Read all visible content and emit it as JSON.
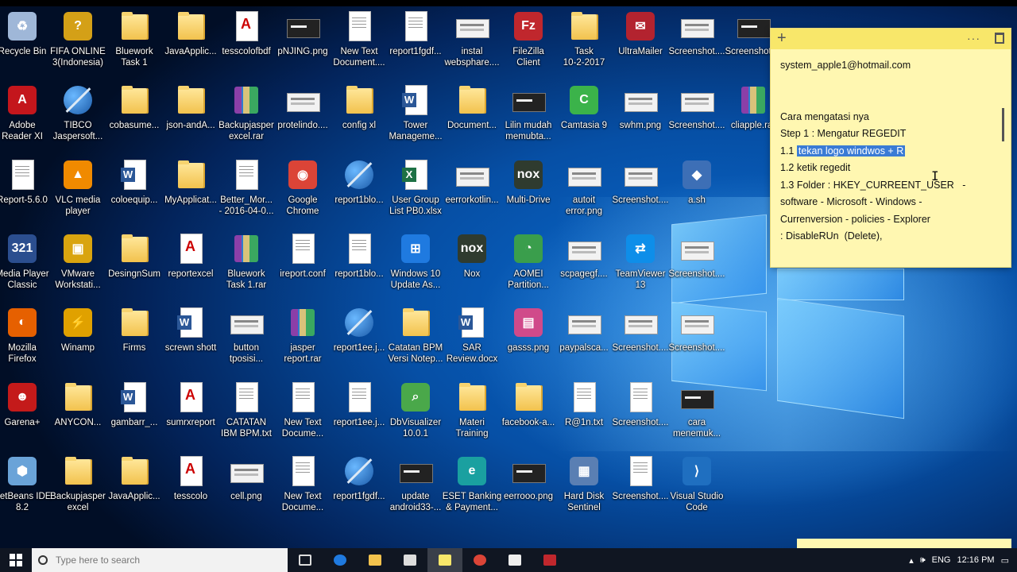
{
  "desktop": {
    "icons": [
      {
        "label": "Recycle Bin",
        "kind": "app",
        "icon": "recycle-bin-icon",
        "color": "#9fb7d8",
        "glyph": "♻"
      },
      {
        "label": "FIFA ONLINE\n3(Indonesia)",
        "kind": "app",
        "icon": "fifa-icon",
        "color": "#d4a017",
        "glyph": "?"
      },
      {
        "label": "Bluework\nTask 1",
        "kind": "folder",
        "icon": "folder-icon"
      },
      {
        "label": "JavaApplic...",
        "kind": "folder",
        "icon": "folder-icon"
      },
      {
        "label": "tesscolofbdf",
        "kind": "pdf",
        "icon": "pdf-folder-icon"
      },
      {
        "label": "pNJING.png",
        "kind": "dark",
        "icon": "image-file-icon"
      },
      {
        "label": "New Text\nDocument....",
        "kind": "doc",
        "icon": "text-file-icon"
      },
      {
        "label": "report1fgdf...",
        "kind": "doc",
        "icon": "report-file-icon"
      },
      {
        "label": "instal\nwebsphare....",
        "kind": "img",
        "icon": "image-file-icon"
      },
      {
        "label": "FileZilla\nClient",
        "kind": "app",
        "icon": "filezilla-icon",
        "color": "#c0272d",
        "glyph": "Fz"
      },
      {
        "label": "Task\n10-2-2017",
        "kind": "folder",
        "icon": "folder-icon"
      },
      {
        "label": "UltraMailer",
        "kind": "app",
        "icon": "ultramailer-icon",
        "color": "#b3232f",
        "glyph": "✉"
      },
      {
        "label": "Screenshot....",
        "kind": "img",
        "icon": "image-file-icon"
      },
      {
        "label": "Screenshot....",
        "kind": "dark",
        "icon": "image-file-icon"
      },
      {
        "label": "Adobe\nReader XI",
        "kind": "app",
        "icon": "adobe-reader-icon",
        "color": "#c4161c",
        "glyph": "A"
      },
      {
        "label": "TIBCO\nJaspersoft...",
        "kind": "ball",
        "icon": "jaspersoft-icon"
      },
      {
        "label": "cobasume...",
        "kind": "folder",
        "icon": "folder-icon"
      },
      {
        "label": "json-andA...",
        "kind": "folder",
        "icon": "folder-icon"
      },
      {
        "label": "Backupjasper\nexcel.rar",
        "kind": "rar",
        "icon": "rar-archive-icon"
      },
      {
        "label": "protelindo....",
        "kind": "img",
        "icon": "image-file-icon"
      },
      {
        "label": "config xl",
        "kind": "folder",
        "icon": "folder-icon"
      },
      {
        "label": "Tower\nManageme...",
        "kind": "word",
        "icon": "word-document-icon"
      },
      {
        "label": "Document...",
        "kind": "folder",
        "icon": "folder-icon"
      },
      {
        "label": "Lilin mudah\nmemubta...",
        "kind": "dark",
        "icon": "image-file-icon"
      },
      {
        "label": "Camtasia 9",
        "kind": "app",
        "icon": "camtasia-icon",
        "color": "#3bb34a",
        "glyph": "C"
      },
      {
        "label": "swhm.png",
        "kind": "img",
        "icon": "image-file-icon"
      },
      {
        "label": "Screenshot....",
        "kind": "img",
        "icon": "image-file-icon"
      },
      {
        "label": "cliapple.rar",
        "kind": "rar",
        "icon": "rar-archive-icon"
      },
      {
        "label": "Report-5.6.0",
        "kind": "doc",
        "icon": "report-file-icon"
      },
      {
        "label": "VLC media\nplayer",
        "kind": "app",
        "icon": "vlc-icon",
        "color": "#f08a00",
        "glyph": "▲"
      },
      {
        "label": "coloequip...",
        "kind": "word",
        "icon": "word-folder-icon"
      },
      {
        "label": "MyApplicat...",
        "kind": "folder",
        "icon": "folder-icon"
      },
      {
        "label": "Better_Mor...\n- 2016-04-0...",
        "kind": "doc",
        "icon": "text-file-icon"
      },
      {
        "label": "Google\nChrome",
        "kind": "app",
        "icon": "chrome-icon",
        "color": "#db4437",
        "glyph": "◉"
      },
      {
        "label": "report1blo...",
        "kind": "ball",
        "icon": "jaspersoft-icon"
      },
      {
        "label": "User Group\nList PB0.xlsx",
        "kind": "excel",
        "icon": "excel-file-icon"
      },
      {
        "label": "eerrorkotlin...",
        "kind": "img",
        "icon": "image-file-icon"
      },
      {
        "label": "Multi-Drive",
        "kind": "app",
        "icon": "nox-multidrive-icon",
        "color": "#2f3b2f",
        "glyph": "nox"
      },
      {
        "label": "autoit\nerror.png",
        "kind": "img",
        "icon": "image-file-icon"
      },
      {
        "label": "Screenshot....",
        "kind": "img",
        "icon": "image-file-icon"
      },
      {
        "label": "a.sh",
        "kind": "app",
        "icon": "git-bash-icon",
        "color": "#3d6fb6",
        "glyph": "◆"
      },
      {
        "label": "Media Player\nClassic",
        "kind": "app",
        "icon": "media-player-classic-icon",
        "color": "#2b4e8f",
        "glyph": "321"
      },
      {
        "label": "VMware\nWorkstati...",
        "kind": "app",
        "icon": "vmware-icon",
        "color": "#d9a40f",
        "glyph": "▣"
      },
      {
        "label": "DesingnSum",
        "kind": "folder",
        "icon": "folder-icon"
      },
      {
        "label": "reportexcel",
        "kind": "pdf",
        "icon": "pdf-folder-icon"
      },
      {
        "label": "Bluework\nTask 1.rar",
        "kind": "rar",
        "icon": "rar-archive-icon"
      },
      {
        "label": "ireport.conf",
        "kind": "doc",
        "icon": "text-file-icon"
      },
      {
        "label": "report1blo...",
        "kind": "doc",
        "icon": "report-file-icon"
      },
      {
        "label": "Windows 10\nUpdate As...",
        "kind": "app",
        "icon": "windows-update-icon",
        "color": "#1f7ae0",
        "glyph": "⊞"
      },
      {
        "label": "Nox",
        "kind": "app",
        "icon": "nox-icon",
        "color": "#2f3b2f",
        "glyph": "nox"
      },
      {
        "label": "AOMEI\nPartition...",
        "kind": "app",
        "icon": "aomei-icon",
        "color": "#3a9e4c",
        "glyph": "◔"
      },
      {
        "label": "scpagegf....",
        "kind": "img",
        "icon": "image-file-icon"
      },
      {
        "label": "TeamViewer\n13",
        "kind": "app",
        "icon": "teamviewer-icon",
        "color": "#0e8ee9",
        "glyph": "⇄"
      },
      {
        "label": "Screenshot....",
        "kind": "img",
        "icon": "image-file-icon"
      },
      {
        "label": "Mozilla\nFirefox",
        "kind": "app",
        "icon": "firefox-icon",
        "color": "#e66000",
        "glyph": "◐"
      },
      {
        "label": "Winamp",
        "kind": "app",
        "icon": "winamp-icon",
        "color": "#e0a100",
        "glyph": "⚡"
      },
      {
        "label": "Firms",
        "kind": "folder",
        "icon": "folder-icon"
      },
      {
        "label": "screwn shott",
        "kind": "word",
        "icon": "word-folder-icon"
      },
      {
        "label": "button\ntposisi...",
        "kind": "img",
        "icon": "image-file-icon"
      },
      {
        "label": "jasper\nreport.rar",
        "kind": "rar",
        "icon": "rar-archive-icon"
      },
      {
        "label": "report1ee.j...",
        "kind": "ball",
        "icon": "jaspersoft-icon"
      },
      {
        "label": "Catatan BPM\nVersi Notep...",
        "kind": "folder",
        "icon": "folder-icon"
      },
      {
        "label": "SAR\nReview.docx",
        "kind": "word",
        "icon": "word-document-icon"
      },
      {
        "label": "gasss.png",
        "kind": "app",
        "icon": "image-file-icon",
        "color": "#d04a8a",
        "glyph": "▤"
      },
      {
        "label": "paypalsca...",
        "kind": "img",
        "icon": "image-file-icon"
      },
      {
        "label": "Screenshot....",
        "kind": "img",
        "icon": "image-file-icon"
      },
      {
        "label": "Screenshot....",
        "kind": "img",
        "icon": "image-file-icon"
      },
      {
        "label": "Garena+",
        "kind": "app",
        "icon": "garena-icon",
        "color": "#c41a1a",
        "glyph": "☻"
      },
      {
        "label": "ANYCON...",
        "kind": "folder",
        "icon": "folder-icon"
      },
      {
        "label": "gambarr_...",
        "kind": "word",
        "icon": "word-folder-icon"
      },
      {
        "label": "sumrxreport",
        "kind": "pdf",
        "icon": "pdf-folder-icon"
      },
      {
        "label": "CATATAN\nIBM BPM.txt",
        "kind": "doc",
        "icon": "text-file-icon"
      },
      {
        "label": "New Text\nDocume...",
        "kind": "doc",
        "icon": "text-file-icon"
      },
      {
        "label": "report1ee.j...",
        "kind": "doc",
        "icon": "report-file-icon"
      },
      {
        "label": "DbVisualizer\n10.0.1",
        "kind": "app",
        "icon": "dbvisualizer-icon",
        "color": "#4aa84a",
        "glyph": "⌕"
      },
      {
        "label": "Materi\nTraining",
        "kind": "folder",
        "icon": "folder-icon"
      },
      {
        "label": "facebook-a...",
        "kind": "folder",
        "icon": "folder-icon"
      },
      {
        "label": "R@1n.txt",
        "kind": "doc",
        "icon": "text-file-icon"
      },
      {
        "label": "Screenshot....",
        "kind": "doc",
        "icon": "image-file-icon"
      },
      {
        "label": "cara\nmenemuk...",
        "kind": "dark",
        "icon": "image-file-icon"
      },
      {
        "label": "NetBeans IDE\n8.2",
        "kind": "app",
        "icon": "netbeans-icon",
        "color": "#6aa3d8",
        "glyph": "⬢"
      },
      {
        "label": "Backupjasper\nexcel",
        "kind": "folder",
        "icon": "folder-icon"
      },
      {
        "label": "JavaApplic...",
        "kind": "folder",
        "icon": "folder-icon"
      },
      {
        "label": "tesscolo",
        "kind": "pdf",
        "icon": "pdf-folder-icon"
      },
      {
        "label": "cell.png",
        "kind": "img",
        "icon": "image-file-icon"
      },
      {
        "label": "New Text\nDocume...",
        "kind": "doc",
        "icon": "text-file-icon"
      },
      {
        "label": "report1fgdf...",
        "kind": "ball",
        "icon": "jaspersoft-icon"
      },
      {
        "label": "update\nandroid33-...",
        "kind": "dark",
        "icon": "image-file-icon"
      },
      {
        "label": "ESET Banking\n& Payment...",
        "kind": "app",
        "icon": "eset-icon",
        "color": "#1aa0a0",
        "glyph": "e"
      },
      {
        "label": "eerrooo.png",
        "kind": "dark",
        "icon": "image-file-icon"
      },
      {
        "label": "Hard Disk\nSentinel",
        "kind": "app",
        "icon": "hard-disk-sentinel-icon",
        "color": "#5a7fb3",
        "glyph": "▦"
      },
      {
        "label": "Screenshot....",
        "kind": "doc",
        "icon": "image-file-icon"
      },
      {
        "label": "Visual Studio\nCode",
        "kind": "app",
        "icon": "vscode-icon",
        "color": "#1f6fc0",
        "glyph": "⟩"
      }
    ]
  },
  "sticky_note": {
    "add_label": "+",
    "more_label": "···",
    "lines": [
      {
        "text": "system_apple1@hotmail.com",
        "selected": ""
      },
      {
        "text": "",
        "selected": ""
      },
      {
        "text": "",
        "selected": ""
      },
      {
        "text": "Cara mengatasi nya",
        "selected": ""
      },
      {
        "text": "Step 1 : Mengatur REGEDIT",
        "selected": ""
      },
      {
        "text": "1.1 ",
        "selected": "tekan logo windwos + R"
      },
      {
        "text": "1.2 ketik regedit",
        "selected": ""
      },
      {
        "text": "1.3 Folder : HKEY_CURREENT_USER   -",
        "selected": ""
      },
      {
        "text": "software - Microsoft - Windows -",
        "selected": ""
      },
      {
        "text": "Currenversion - policies - Explorer",
        "selected": ""
      },
      {
        "text": ": DisableRUn  (Delete),",
        "selected": ""
      }
    ]
  },
  "taskbar": {
    "search_placeholder": "Type here to search",
    "clock": "12:16 PM",
    "language": "ENG"
  },
  "colors": {
    "sticky_bg": "#fff7b1",
    "sticky_bar": "#f8e76a",
    "selection": "#3a7bd5",
    "taskbar": "#101622"
  }
}
